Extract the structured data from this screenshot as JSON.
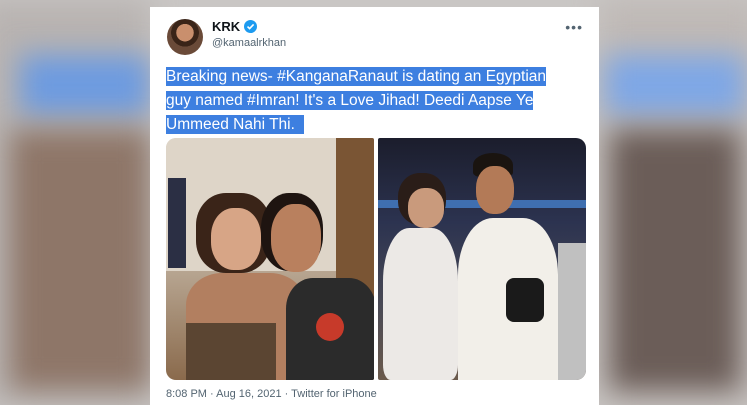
{
  "tweet": {
    "author_name": "KRK",
    "author_handle": "@kamaalrkhan",
    "more_label": "•••",
    "text_lines": [
      "Breaking news- #KanganaRanaut is dating an Egyptian",
      "guy named #Imran! It's a Love Jihad! Deedi Aapse Ye",
      "Ummeed Nahi Thi."
    ],
    "timestamp": "8:08 PM · Aug 16, 2021 · Twitter for iPhone"
  },
  "colors": {
    "verified_badge": "#1d9bf0",
    "selection_highlight": "#3d7fe0",
    "secondary_text": "#536471"
  },
  "icons": [
    "verified-icon",
    "more-icon"
  ]
}
